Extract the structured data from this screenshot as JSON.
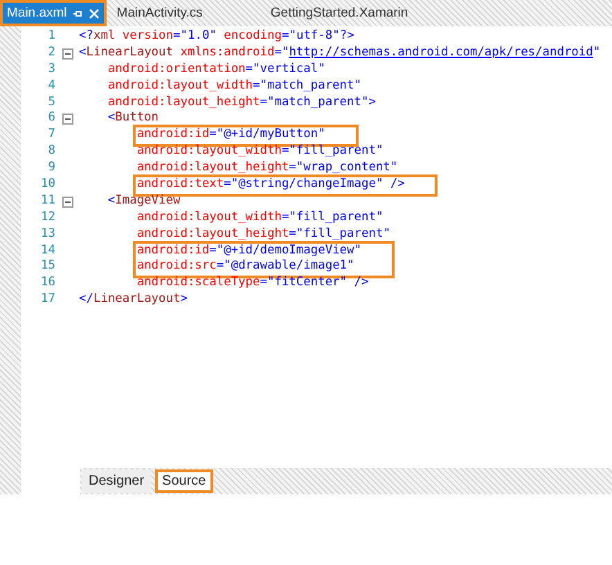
{
  "document_tabs": [
    {
      "label": "Main.axml",
      "selected": true,
      "pinned": true,
      "closable": true
    },
    {
      "label": "MainActivity.cs",
      "selected": false,
      "pinned": false,
      "closable": false
    },
    {
      "label": "GettingStarted.Xamarin",
      "selected": false,
      "pinned": false,
      "closable": false
    }
  ],
  "editor": {
    "lines": [
      {
        "number": "1",
        "foldable": false,
        "highlight": false,
        "tokens": [
          {
            "kind": "delim",
            "text": "<?"
          },
          {
            "kind": "tag",
            "text": "xml"
          },
          {
            "kind": "attr",
            "text": " version"
          },
          {
            "kind": "delim",
            "text": "=\""
          },
          {
            "kind": "value",
            "text": "1.0"
          },
          {
            "kind": "delim",
            "text": "\""
          },
          {
            "kind": "attr",
            "text": " encoding"
          },
          {
            "kind": "delim",
            "text": "=\""
          },
          {
            "kind": "value",
            "text": "utf-8"
          },
          {
            "kind": "delim",
            "text": "\"?>"
          }
        ]
      },
      {
        "number": "2",
        "foldable": true,
        "highlight": false,
        "tokens": [
          {
            "kind": "delim",
            "text": "<"
          },
          {
            "kind": "tag",
            "text": "LinearLayout"
          },
          {
            "kind": "attr",
            "text": " xmlns:android"
          },
          {
            "kind": "delim",
            "text": "=\""
          },
          {
            "kind": "link",
            "text": "http://schemas.android.com/apk/res/android"
          },
          {
            "kind": "delim",
            "text": "\""
          }
        ]
      },
      {
        "number": "3",
        "foldable": false,
        "highlight": false,
        "tokens": [
          {
            "kind": "attr",
            "text": "    android:orientation"
          },
          {
            "kind": "delim",
            "text": "=\""
          },
          {
            "kind": "value",
            "text": "vertical"
          },
          {
            "kind": "delim",
            "text": "\""
          }
        ]
      },
      {
        "number": "4",
        "foldable": false,
        "highlight": false,
        "tokens": [
          {
            "kind": "attr",
            "text": "    android:layout_width"
          },
          {
            "kind": "delim",
            "text": "=\""
          },
          {
            "kind": "value",
            "text": "match_parent"
          },
          {
            "kind": "delim",
            "text": "\""
          }
        ]
      },
      {
        "number": "5",
        "foldable": false,
        "highlight": false,
        "tokens": [
          {
            "kind": "attr",
            "text": "    android:layout_height"
          },
          {
            "kind": "delim",
            "text": "=\""
          },
          {
            "kind": "value",
            "text": "match_parent"
          },
          {
            "kind": "delim",
            "text": "\">"
          }
        ]
      },
      {
        "number": "6",
        "foldable": true,
        "highlight": false,
        "tokens": [
          {
            "kind": "delim",
            "text": "    <"
          },
          {
            "kind": "tag",
            "text": "Button"
          }
        ]
      },
      {
        "number": "7",
        "foldable": false,
        "highlight": true,
        "tokens": [
          {
            "kind": "attr",
            "text": "        android:id"
          },
          {
            "kind": "delim",
            "text": "=\""
          },
          {
            "kind": "value",
            "text": "@+id/myButton"
          },
          {
            "kind": "delim",
            "text": "\""
          }
        ]
      },
      {
        "number": "8",
        "foldable": false,
        "highlight": false,
        "tokens": [
          {
            "kind": "attr",
            "text": "        android:layout_width"
          },
          {
            "kind": "delim",
            "text": "=\""
          },
          {
            "kind": "value",
            "text": "fill_parent"
          },
          {
            "kind": "delim",
            "text": "\""
          }
        ]
      },
      {
        "number": "9",
        "foldable": false,
        "highlight": false,
        "tokens": [
          {
            "kind": "attr",
            "text": "        android:layout_height"
          },
          {
            "kind": "delim",
            "text": "=\""
          },
          {
            "kind": "value",
            "text": "wrap_content"
          },
          {
            "kind": "delim",
            "text": "\""
          }
        ]
      },
      {
        "number": "10",
        "foldable": false,
        "highlight": true,
        "tokens": [
          {
            "kind": "attr",
            "text": "        android:text"
          },
          {
            "kind": "delim",
            "text": "=\""
          },
          {
            "kind": "value",
            "text": "@string/changeImage"
          },
          {
            "kind": "delim",
            "text": "\" />"
          }
        ]
      },
      {
        "number": "11",
        "foldable": true,
        "highlight": false,
        "tokens": [
          {
            "kind": "delim",
            "text": "    <"
          },
          {
            "kind": "tag",
            "text": "ImageView"
          }
        ]
      },
      {
        "number": "12",
        "foldable": false,
        "highlight": false,
        "tokens": [
          {
            "kind": "attr",
            "text": "        android:layout_width"
          },
          {
            "kind": "delim",
            "text": "=\""
          },
          {
            "kind": "value",
            "text": "fill_parent"
          },
          {
            "kind": "delim",
            "text": "\""
          }
        ]
      },
      {
        "number": "13",
        "foldable": false,
        "highlight": false,
        "tokens": [
          {
            "kind": "attr",
            "text": "        android:layout_height"
          },
          {
            "kind": "delim",
            "text": "=\""
          },
          {
            "kind": "value",
            "text": "fill_parent"
          },
          {
            "kind": "delim",
            "text": "\""
          }
        ]
      },
      {
        "number": "14",
        "foldable": false,
        "highlight": true,
        "tokens": [
          {
            "kind": "attr",
            "text": "        android:id"
          },
          {
            "kind": "delim",
            "text": "=\""
          },
          {
            "kind": "value",
            "text": "@+id/demoImageView"
          },
          {
            "kind": "delim",
            "text": "\""
          }
        ]
      },
      {
        "number": "15",
        "foldable": false,
        "highlight": true,
        "tokens": [
          {
            "kind": "attr",
            "text": "        android:src"
          },
          {
            "kind": "delim",
            "text": "=\""
          },
          {
            "kind": "value",
            "text": "@drawable/image1"
          },
          {
            "kind": "delim",
            "text": "\""
          }
        ]
      },
      {
        "number": "16",
        "foldable": false,
        "highlight": false,
        "tokens": [
          {
            "kind": "attr",
            "text": "        android:scaleType"
          },
          {
            "kind": "delim",
            "text": "=\""
          },
          {
            "kind": "value",
            "text": "fitCenter"
          },
          {
            "kind": "delim",
            "text": "\" />"
          }
        ]
      },
      {
        "number": "17",
        "foldable": false,
        "highlight": false,
        "tokens": [
          {
            "kind": "delim",
            "text": "</"
          },
          {
            "kind": "tag",
            "text": "LinearLayout"
          },
          {
            "kind": "delim",
            "text": ">"
          }
        ]
      }
    ]
  },
  "view_tabs": [
    {
      "label": "Designer",
      "selected": false
    },
    {
      "label": "Source",
      "selected": true
    }
  ]
}
